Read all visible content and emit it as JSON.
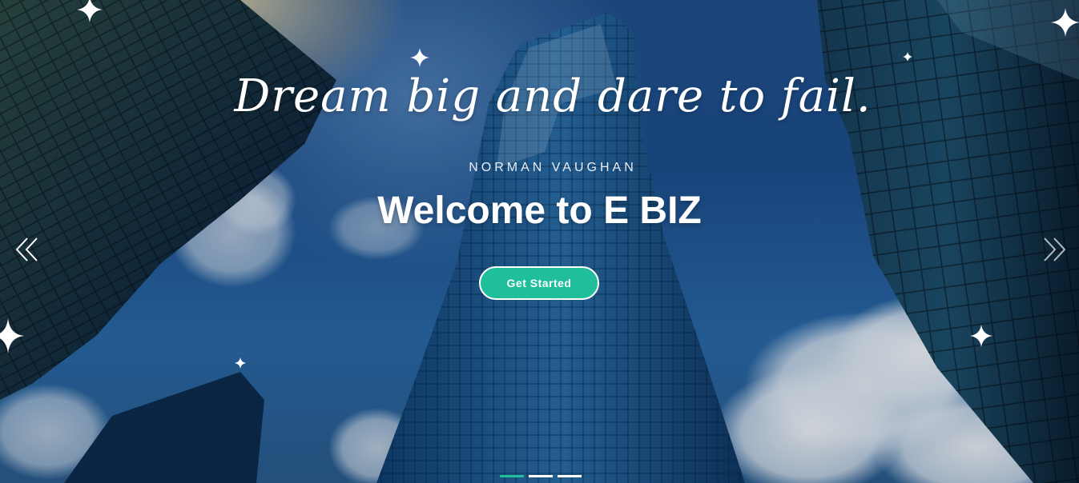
{
  "hero": {
    "quote": "Dream big and dare to fail.",
    "author": "NORMAN VAUGHAN",
    "title": "Welcome to E BIZ",
    "cta_label": "Get Started"
  },
  "carousel": {
    "prev_icon": "chevron-double-left-icon",
    "next_icon": "chevron-double-right-icon",
    "slide_count": 3,
    "active_slide": 1
  },
  "colors": {
    "accent": "#1fbf9c",
    "text": "#ffffff",
    "sky": "#1d4f8c"
  }
}
